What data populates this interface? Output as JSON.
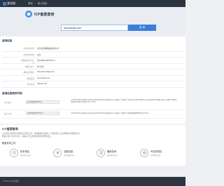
{
  "header": {
    "logo": "爱站网",
    "nav": [
      "首页",
      "收入网站"
    ]
  },
  "banner": {
    "title": "ICP备案查询",
    "input_value": "taroroshijiu.com",
    "button": "查 询"
  },
  "info": {
    "title": "备案信息",
    "rows": [
      {
        "label": "主办单位名称",
        "value": "南京松花联网科技有限公司"
      },
      {
        "label": "主办单位性质",
        "value": "企业"
      },
      {
        "label": "网站备案/许可证号",
        "value": "苏ICP备16053787号-3"
      },
      {
        "label": "网站负责人",
        "value": "陈人民军"
      },
      {
        "label": "网站首页网址",
        "value": "www.taroroshijiu.com"
      },
      {
        "label": "网站域名",
        "value": "taroroshijiu.com"
      },
      {
        "label": "审核时间",
        "value": "2019-04-18"
      }
    ]
  },
  "snippets": {
    "title": "备案信息网页代码",
    "rows": [
      {
        "label": "文字链接",
        "box": "苏ICP备16053787号",
        "code": "<a href=\"http://aizhan.com/icp.php?url=taroroshijiu.com\" target=\"_blank\"><img src=\"http://aizhan.com/icp/taroroshijiu.com\" width=\"123px\" height=\"35px\" border=\"0\" /></a>"
      },
      {
        "label": "图片 样式",
        "box": "苏ICP备16053787号-3",
        "code": "<a href=\"http://aizhan.com/icp.php?url=taroroshijiu.com\" target=\"_blank\">苏ICP备16053787号-3</a>"
      }
    ]
  },
  "faq": {
    "title": "ICP备案查询",
    "lines": [
      "工业和信息化部ICP备案信息查询工具，备案数据实时更新，查询结果以工信部网站实际数据为准。",
      "网站负责人等信息有误，请联系工信部或当地通信管理局更正。"
    ]
  },
  "tools": {
    "title": "备案查询工具",
    "items": [
      {
        "label": "历史域名",
        "sub": "域名历史查询"
      },
      {
        "label": "百度权重",
        "sub": "百度权重查询"
      },
      {
        "label": "备案查询",
        "sub": "网站备案查询"
      },
      {
        "label": "IP反查域名",
        "sub": "同IP网站查询"
      }
    ]
  },
  "footer": {
    "text": "©2006-2019 爱站网"
  }
}
